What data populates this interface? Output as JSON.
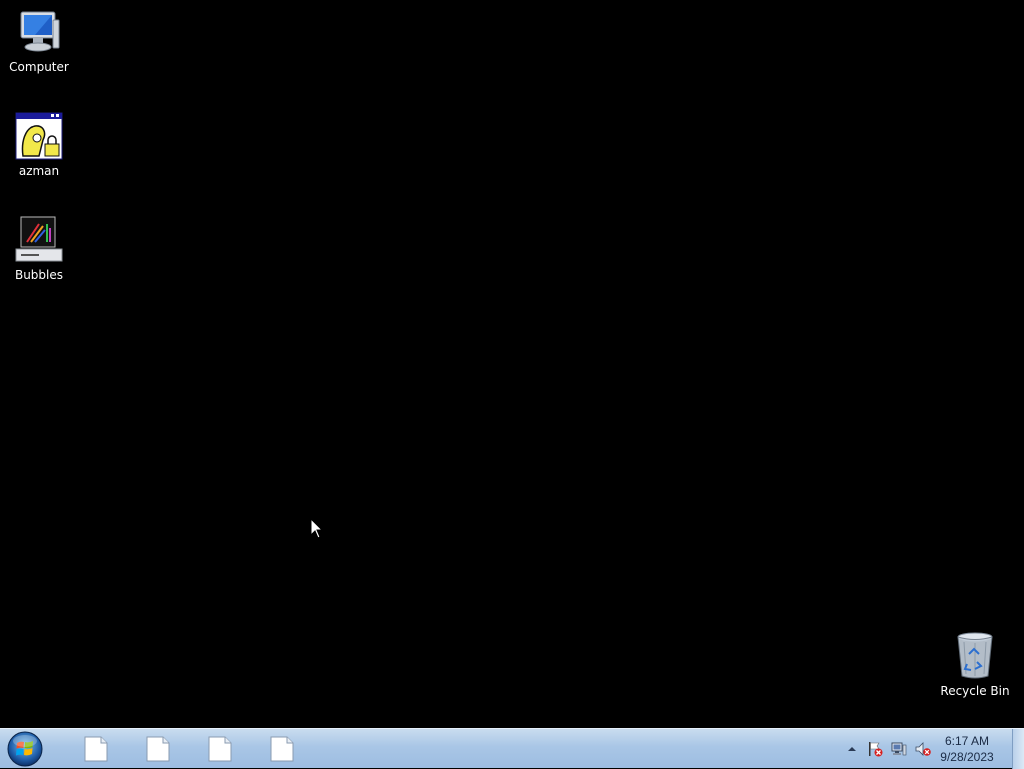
{
  "desktop": {
    "icons": [
      {
        "label": "Computer",
        "icon": "computer-icon"
      },
      {
        "label": "azman",
        "icon": "azman-icon"
      },
      {
        "label": "Bubbles",
        "icon": "bubbles-screensaver-icon"
      },
      {
        "label": "Recycle Bin",
        "icon": "recycle-bin-icon"
      }
    ],
    "background_color": "#000000"
  },
  "taskbar": {
    "start_icon": "windows-start-orb",
    "buttons": [
      {
        "icon": "blank-document-icon"
      },
      {
        "icon": "blank-document-icon"
      },
      {
        "icon": "blank-document-icon"
      },
      {
        "icon": "blank-document-icon"
      }
    ],
    "tray": {
      "icons": [
        "show-hidden-icons-arrow",
        "action-center-flag-icon",
        "network-error-icon",
        "volume-muted-icon"
      ],
      "time": "6:17 AM",
      "date": "9/28/2023"
    }
  }
}
